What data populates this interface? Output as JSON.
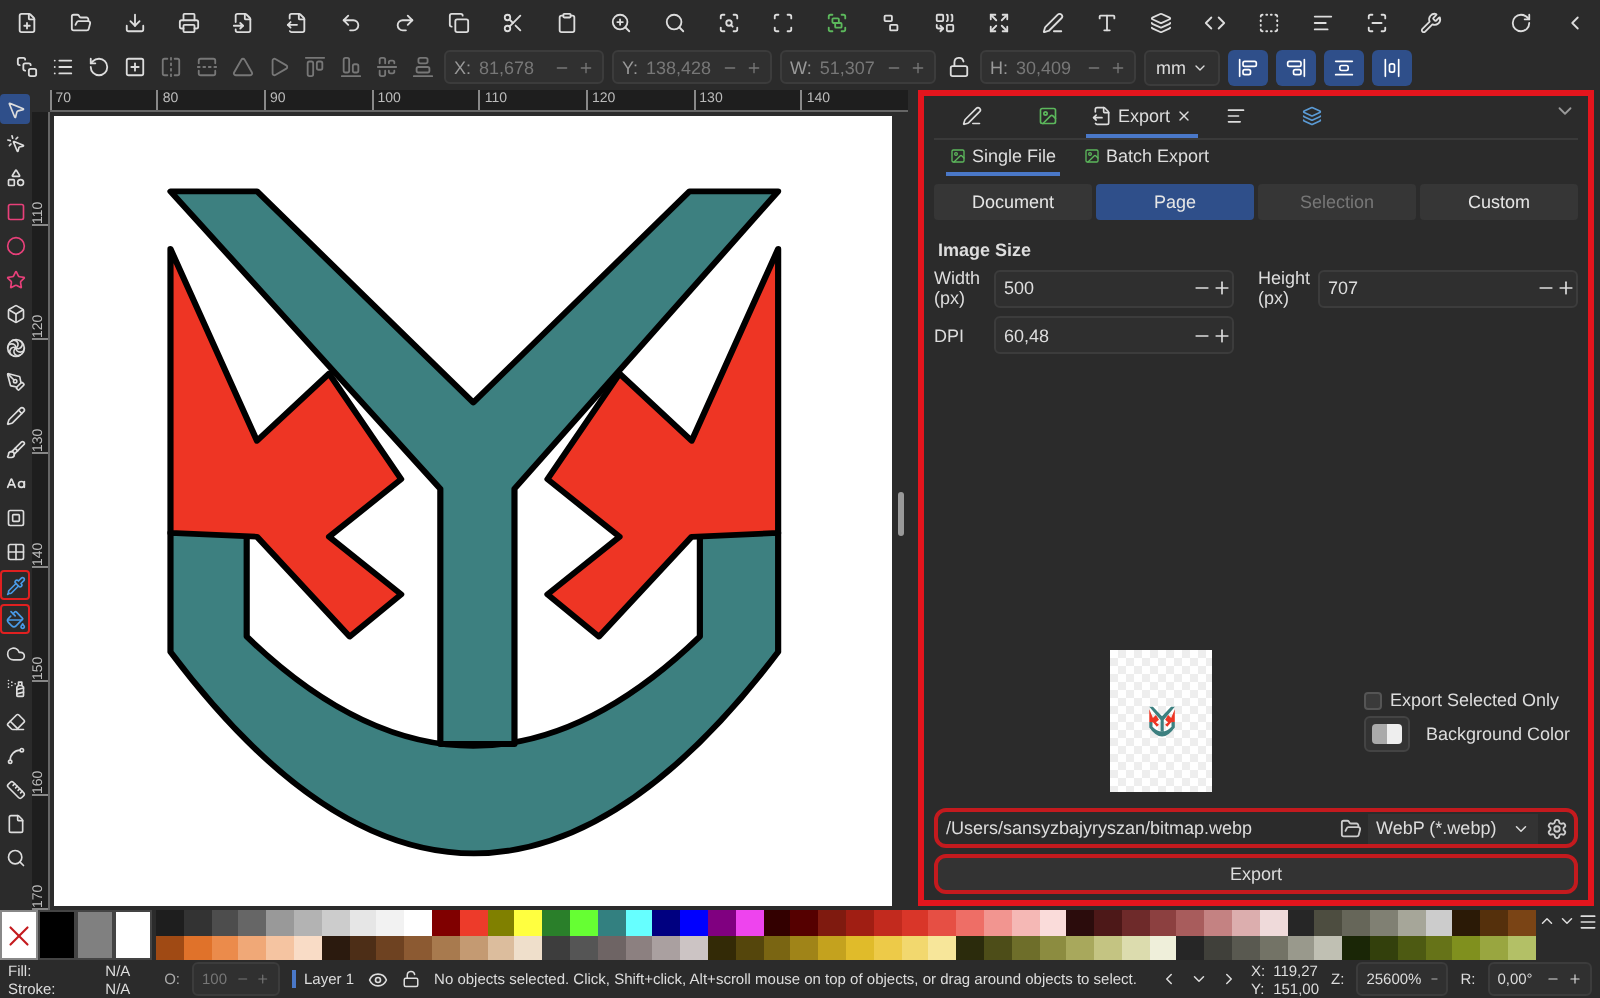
{
  "transform": {
    "fields": [
      {
        "label": "X:",
        "value": "81,678",
        "disabled": true
      },
      {
        "label": "Y:",
        "value": "138,428",
        "disabled": true
      },
      {
        "label": "W:",
        "value": "51,307",
        "disabled": true
      },
      {
        "label": "H:",
        "value": "30,409",
        "disabled": true
      }
    ],
    "unit": "mm"
  },
  "tools": [
    {
      "selected": true,
      "highlighted": false
    },
    {
      "selected": false,
      "highlighted": false
    },
    {
      "selected": false,
      "highlighted": false
    },
    {
      "selected": false,
      "highlighted": false
    },
    {
      "selected": false,
      "highlighted": false
    },
    {
      "selected": false,
      "highlighted": false
    },
    {
      "selected": false,
      "highlighted": false
    },
    {
      "selected": false,
      "highlighted": false
    },
    {
      "selected": false,
      "highlighted": false
    },
    {
      "selected": false,
      "highlighted": false
    },
    {
      "selected": false,
      "highlighted": false
    },
    {
      "selected": false,
      "highlighted": false
    },
    {
      "selected": false,
      "highlighted": false
    },
    {
      "selected": false,
      "highlighted": false
    },
    {
      "selected": false,
      "highlighted": true
    },
    {
      "selected": false,
      "highlighted": true
    },
    {
      "selected": false,
      "highlighted": false
    },
    {
      "selected": false,
      "highlighted": false
    },
    {
      "selected": false,
      "highlighted": false
    },
    {
      "selected": false,
      "highlighted": false
    },
    {
      "selected": false,
      "highlighted": false
    },
    {
      "selected": false,
      "highlighted": false
    },
    {
      "selected": false,
      "highlighted": false
    }
  ],
  "rulers": {
    "horizontal": [
      "70",
      "80",
      "90",
      "100",
      "110",
      "120",
      "130",
      "140"
    ],
    "vertical": [
      "110",
      "120",
      "130",
      "140",
      "150",
      "160",
      "170"
    ]
  },
  "panel": {
    "tabs": [
      {
        "kind": "icon",
        "selected": false
      },
      {
        "kind": "icon",
        "selected": false
      },
      {
        "kind": "label",
        "label": "Export",
        "selected": true
      },
      {
        "kind": "icon",
        "selected": false
      },
      {
        "kind": "icon",
        "selected": false
      }
    ],
    "modes": [
      {
        "label": "Single File",
        "selected": true
      },
      {
        "label": "Batch Export",
        "selected": false
      }
    ],
    "areas": [
      {
        "label": "Document",
        "selected": false,
        "disabled": false
      },
      {
        "label": "Page",
        "selected": true,
        "disabled": false
      },
      {
        "label": "Selection",
        "selected": false,
        "disabled": true
      },
      {
        "label": "Custom",
        "selected": false,
        "disabled": false
      }
    ],
    "section_title": "Image Size",
    "fields": [
      {
        "label": "Width (px)",
        "value": "500"
      },
      {
        "label": "Height (px)",
        "value": "707"
      },
      {
        "label": "DPI",
        "value": "60,48"
      }
    ],
    "export_selected_only": {
      "label": "Export Selected Only",
      "checked": false
    },
    "background_color": {
      "label": "Background Color"
    },
    "filename": "/Users/sansyzbajyryszan/bitmap.webp",
    "format": "WebP (*.webp)",
    "export_button": "Export"
  },
  "palette": {
    "large": [
      {
        "color": "#000000"
      },
      {
        "color": "#808080"
      },
      {
        "color": "#ffffff"
      }
    ],
    "rows": [
      [
        {
          "color": "#1e1e1e"
        },
        {
          "color": "#333333"
        },
        {
          "color": "#4d4d4d"
        },
        {
          "color": "#666666"
        },
        {
          "color": "#999999"
        },
        {
          "color": "#b3b3b3"
        },
        {
          "color": "#cccccc"
        },
        {
          "color": "#e6e6e6"
        },
        {
          "color": "#f2f2f2"
        },
        {
          "color": "#ffffff"
        },
        {
          "color": "#800000"
        },
        {
          "color": "#ed3b2a"
        },
        {
          "color": "#808000"
        },
        {
          "color": "#ffff40"
        },
        {
          "color": "#2a7f2a"
        },
        {
          "color": "#66ff33"
        },
        {
          "color": "#338080"
        },
        {
          "color": "#66ffff"
        },
        {
          "color": "#000080"
        },
        {
          "color": "#0000ff"
        },
        {
          "color": "#800080"
        },
        {
          "color": "#ee44ee"
        },
        {
          "color": "#330000"
        },
        {
          "color": "#550000"
        },
        {
          "color": "#7f1a0f"
        },
        {
          "color": "#a01e13"
        },
        {
          "color": "#c22a1e"
        },
        {
          "color": "#d93629"
        },
        {
          "color": "#e64f44"
        },
        {
          "color": "#ee6e66"
        },
        {
          "color": "#f29590"
        },
        {
          "color": "#f5b8b5"
        },
        {
          "color": "#fadcda"
        },
        {
          "color": "#2b0c0c"
        },
        {
          "color": "#4d1818"
        },
        {
          "color": "#6e2a2a"
        },
        {
          "color": "#8c4040"
        },
        {
          "color": "#a85c5c"
        },
        {
          "color": "#c48282"
        },
        {
          "color": "#dcaeae"
        },
        {
          "color": "#efdada"
        },
        {
          "color": "#262626"
        },
        {
          "color": "#4d4d40"
        },
        {
          "color": "#666659"
        },
        {
          "color": "#808073"
        },
        {
          "color": "#a6a699"
        },
        {
          "color": "#cccccc"
        },
        {
          "color": "#2b1a06"
        },
        {
          "color": "#55300c"
        },
        {
          "color": "#7a4415"
        }
      ],
      [
        {
          "color": "#a04a14"
        },
        {
          "color": "#e0722a"
        },
        {
          "color": "#eb8b4b"
        },
        {
          "color": "#f0a877"
        },
        {
          "color": "#f5c4a1"
        },
        {
          "color": "#f9dcc6"
        },
        {
          "color": "#2b1a0e"
        },
        {
          "color": "#4d2e17"
        },
        {
          "color": "#6e4221"
        },
        {
          "color": "#8c5a32"
        },
        {
          "color": "#a87a4e"
        },
        {
          "color": "#c49a72"
        },
        {
          "color": "#dcbd9d"
        },
        {
          "color": "#efdfcb"
        },
        {
          "color": "#3d3d3d"
        },
        {
          "color": "#555555"
        },
        {
          "color": "#6e6464"
        },
        {
          "color": "#8c8080"
        },
        {
          "color": "#aaa0a0"
        },
        {
          "color": "#ccc4c4"
        },
        {
          "color": "#332a06"
        },
        {
          "color": "#55460c"
        },
        {
          "color": "#7a6512"
        },
        {
          "color": "#a08418"
        },
        {
          "color": "#c4a21e"
        },
        {
          "color": "#e0bb2a"
        },
        {
          "color": "#edca48"
        },
        {
          "color": "#f2d86e"
        },
        {
          "color": "#f7e69a"
        },
        {
          "color": "#2b2b0c"
        },
        {
          "color": "#4d4d18"
        },
        {
          "color": "#6e6e2a"
        },
        {
          "color": "#8c8c40"
        },
        {
          "color": "#a8a85c"
        },
        {
          "color": "#c4c482"
        },
        {
          "color": "#dcdcae"
        },
        {
          "color": "#efefda"
        },
        {
          "color": "#262626"
        },
        {
          "color": "#40403a"
        },
        {
          "color": "#595950"
        },
        {
          "color": "#737366"
        },
        {
          "color": "#99998c"
        },
        {
          "color": "#c0c0b3"
        },
        {
          "color": "#1a2606"
        },
        {
          "color": "#33400c"
        },
        {
          "color": "#4d5a12"
        },
        {
          "color": "#667318"
        },
        {
          "color": "#80901e"
        },
        {
          "color": "#99a640"
        },
        {
          "color": "#b3c066"
        }
      ]
    ]
  },
  "status": {
    "fill_label": "Fill:",
    "fill_value": "N/A",
    "stroke_label": "Stroke:",
    "stroke_value": "N/A",
    "opacity_label": "O:",
    "opacity_value": "100",
    "layer": "Layer 1",
    "message": "No objects selected. Click, Shift+click, Alt+scroll mouse on top of objects, or drag around objects to select.",
    "x_label": "X:",
    "x_value": "119,27",
    "y_label": "Y:",
    "y_value": "151,00",
    "zoom_label": "Z:",
    "zoom_value": "25600%",
    "rotate_label": "R:",
    "rotate_value": "0,00°"
  }
}
